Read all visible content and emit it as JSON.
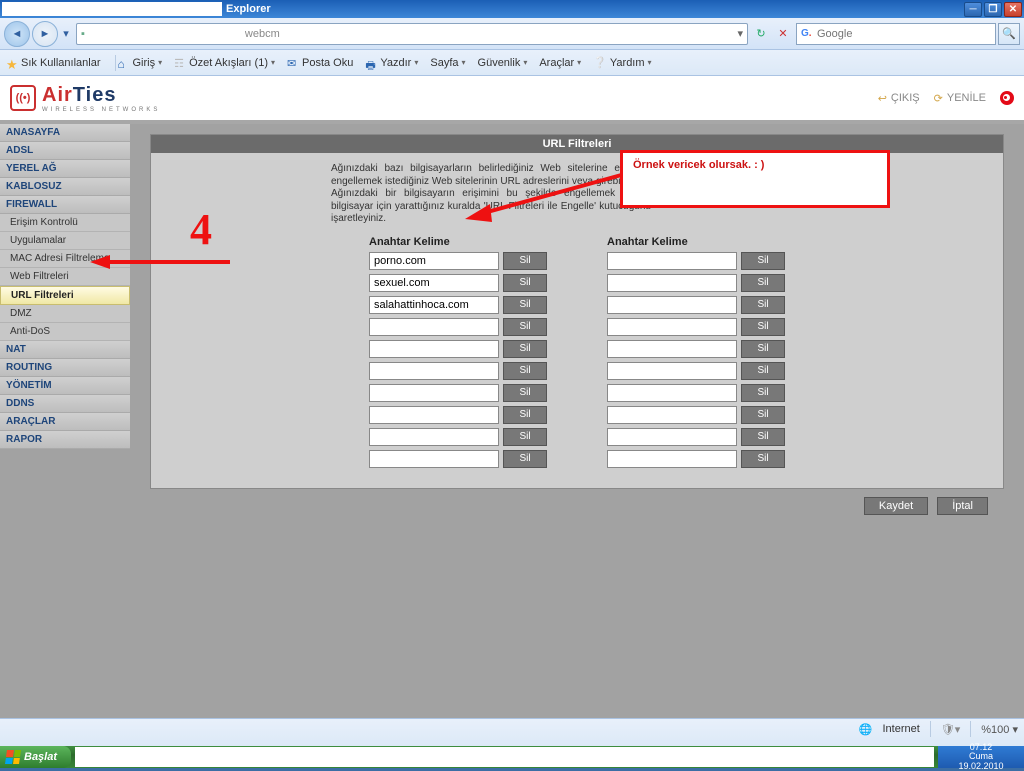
{
  "window": {
    "title_suffix": "Explorer"
  },
  "nav": {
    "address_value": "webcm",
    "search_placeholder": "Google"
  },
  "linksbar": {
    "favorites": "Sık Kullanılanlar",
    "home": "Giriş",
    "feeds": "Özet Akışları (1)",
    "mail": "Posta Oku",
    "print": "Yazdır",
    "page": "Sayfa",
    "safety": "Güvenlik",
    "tools": "Araçlar",
    "help": "Yardım"
  },
  "header": {
    "brand_a": "Air",
    "brand_b": "Ties",
    "sub": "wireless networks",
    "exit": "ÇIKIŞ",
    "refresh": "YENİLE"
  },
  "sidebar": {
    "sections1": [
      "ANASAYFA",
      "ADSL",
      "YEREL AĞ",
      "KABLOSUZ",
      "FIREWALL"
    ],
    "fw_items": [
      "Erişim Kontrolü",
      "Uygulamalar",
      "MAC Adresi Filtreleme",
      "Web Filtreleri",
      "URL Filtreleri",
      "DMZ",
      "Anti-DoS"
    ],
    "sections2": [
      "NAT",
      "ROUTING",
      "YÖNETİM",
      "DDNS",
      "ARAÇLAR",
      "RAPOR"
    ],
    "active": "URL Filtreleri"
  },
  "content": {
    "title": "URL Filtreleri",
    "desc": "Ağınızdaki bazı bilgisayarların belirlediğiniz Web sitelerine erişimini engellemek istediğiniz Web sitelerinin URL adreslerini veya girebilirsiniz. Ağınızdaki bir bilgisayarın erişimini bu şekilde engellemek için o bilgisayar için yarattığınız kuralda 'URL Filtreleri ile Engelle' kutucuğunu işaretleyiniz.",
    "col_head1": "Anahtar Kelime",
    "col_head2": "Anahtar Kelime",
    "delete_label": "Sil",
    "left_values": [
      "porno.com",
      "sexuel.com",
      "salahattinhoca.com",
      "",
      "",
      "",
      "",
      "",
      "",
      ""
    ],
    "right_values": [
      "",
      "",
      "",
      "",
      "",
      "",
      "",
      "",
      "",
      ""
    ],
    "save": "Kaydet",
    "cancel": "İptal"
  },
  "annotation": {
    "number": "4",
    "tip": "Örnek vericek olursak. : )"
  },
  "statusbar": {
    "zone": "Internet",
    "zoom": "%100"
  },
  "taskbar": {
    "start": "Başlat",
    "time": "07:12",
    "day": "Cuma",
    "date": "19.02.2010"
  }
}
